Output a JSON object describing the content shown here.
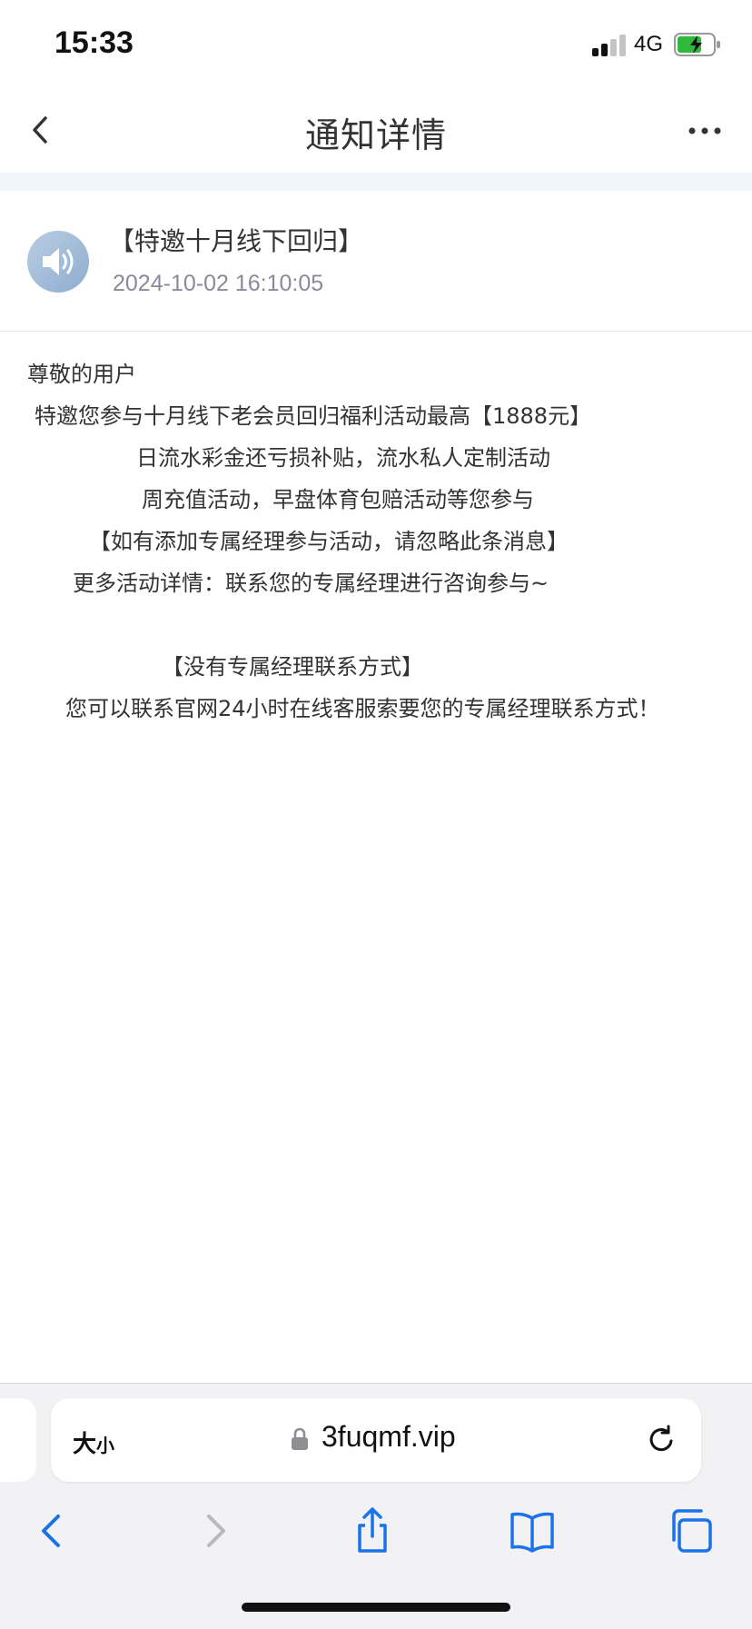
{
  "status_bar": {
    "time": "15:33",
    "network": "4G",
    "battery_color": "#2fb93c"
  },
  "nav": {
    "title": "通知详情",
    "back_icon": "chevron-left-icon",
    "more_icon": "ellipsis-icon"
  },
  "notice": {
    "icon": "speaker-icon",
    "title": "【特邀十月线下回归】",
    "date": "2024-10-02 16:10:05",
    "lines": [
      "尊敬的用户",
      "特邀您参与十月线下老会员回归福利活动最高【1888元】",
      "日流水彩金还亏损补贴，流水私人定制活动",
      "周充值活动，早盘体育包赔活动等您参与",
      "【如有添加专属经理参与活动，请忽略此条消息】",
      "更多活动详情：联系您的专属经理进行咨询参与~",
      "【没有专属经理联系方式】",
      "您可以联系官网24小时在线客服索要您的专属经理联系方式！"
    ]
  },
  "browser": {
    "text_size_label_big": "大",
    "text_size_label_small": "小",
    "url": "3fuqmf.vip",
    "accent": "#1a73e8"
  }
}
